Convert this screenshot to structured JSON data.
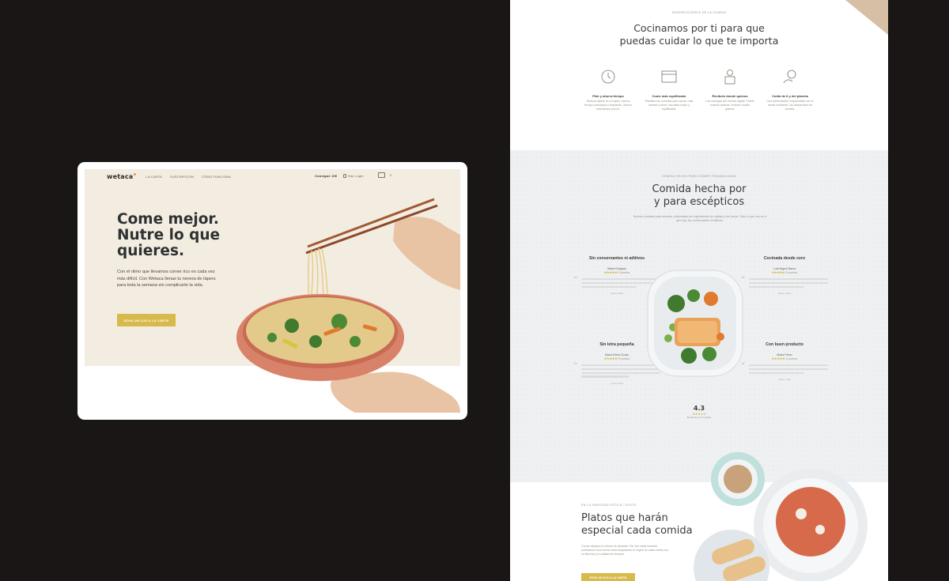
{
  "hero": {
    "logo": "wetaca",
    "nav": [
      "LA CARTA",
      "SUSCRIPCIÓN",
      "CÓMO FUNCIONA"
    ],
    "zip": "Consigue 10€",
    "user": "Haz Login",
    "cart_count": "0",
    "title": "Come mejor.\nNutre lo que\nquieres.",
    "text": "Con el ritmo que llevamos comer rico es cada vez más difícil. Con Wetaca llenas tu nevera de tápers para toda la semana sin complicarte la vida.",
    "cta": "ECHA UN OJO A LA CARTA"
  },
  "section1": {
    "eyebrow": "DESPREOCÚPATE DE LA COMIDA",
    "title": "Cocinamos por ti para que\npuedas cuidar lo que te importa",
    "features": [
      {
        "icon": "clock-icon",
        "title": "Pide y ahorra tiempo",
        "desc": "Nuevos tápers en el súper, menos tiempo cocinando y limpiando. Mucho más tiempo para ti."
      },
      {
        "icon": "calendar-icon",
        "title": "Come más equilibrado",
        "desc": "Planifica tus comidas para comer más variado y tener una dieta mejor y equilibrada."
      },
      {
        "icon": "box-icon",
        "title": "Recíbelo donde quieras",
        "desc": "Las entregas del mundo digital. Pídelo cuando quieras, recíbelo donde quieras."
      },
      {
        "icon": "planet-icon",
        "title": "Cuida de ti y del planeta",
        "desc": "Una alimentación responsable con el medio ambiente, sin desperdicio de comida."
      }
    ]
  },
  "section2": {
    "eyebrow": "COMIDA HECHA PARA COMER TRANQUILIDAD",
    "title": "Comida hecha por\ny para escépticos",
    "text": "Nuevas comidas cada semana, elaboradas con ingredientes de calidad y sin trucos. Todo lo que ves es lo que hay, sin conservantes ni aditivos.",
    "reviews": [
      {
        "heading": "Sin conservantes ni aditivos",
        "name": "Marta Delgado",
        "stars": "★★★★★",
        "rating": "5 puntos",
        "date": "9 junio 2021"
      },
      {
        "heading": "Cocinada desde cero",
        "name": "Luis Miguel Barca",
        "stars": "★★★★★",
        "rating": "5 puntos",
        "date": "Hace 3 días"
      },
      {
        "heading": "Sin letra pequeña",
        "name": "María Elena Sordo",
        "stars": "★★★★★",
        "rating": "5 puntos",
        "date": "2 junio 2021"
      },
      {
        "heading": "Con buen producto",
        "name": "Marta Pérez",
        "stars": "★★★★★",
        "rating": "5 puntos",
        "date": "Hace 1 día"
      }
    ],
    "score": "4.3",
    "score_stars": "★★★★★",
    "score_label": "Excelente en Trustpilot"
  },
  "section3": {
    "eyebrow": "EN LA VARIEDAD ESTÁ EL GUSTO",
    "title": "Platos que harán\nespecial cada comida",
    "text": "Comer siempre lo mismo es aburrido. Por eso cada semana publicamos una nueva carta respetando el origen de cada receta con su libertad y la calidad de siempre.",
    "cta": "ECHA UN OJO A LA CARTA"
  },
  "colors": {
    "accent": "#d8b94c",
    "hero_bg": "#f3ece1",
    "dark_bg": "#1a1616"
  }
}
